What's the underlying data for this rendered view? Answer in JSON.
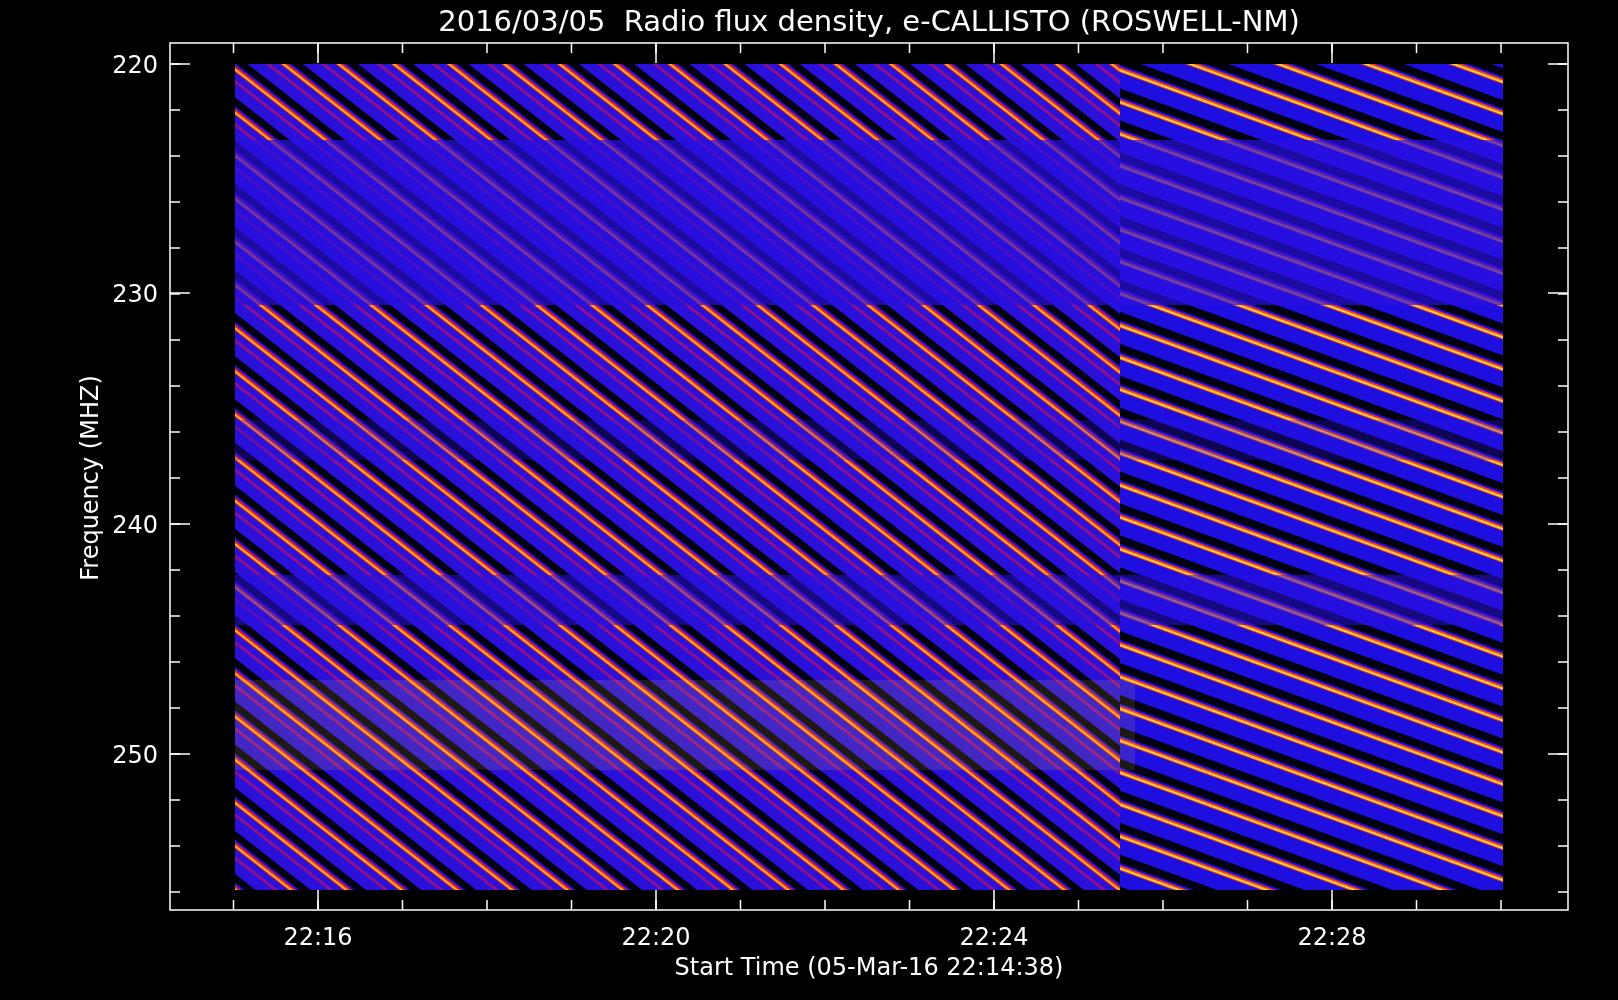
{
  "title": "2016/03/05  Radio flux density, e-CALLISTO (ROSWELL-NM)",
  "y_axis": {
    "title": "Frequency (MHZ)",
    "ticks": [
      "220",
      "230",
      "240",
      "250"
    ]
  },
  "x_axis": {
    "title": "Start Time (05-Mar-16 22:14:38)",
    "ticks": [
      "22:16",
      "22:20",
      "22:24",
      "22:28"
    ]
  }
}
